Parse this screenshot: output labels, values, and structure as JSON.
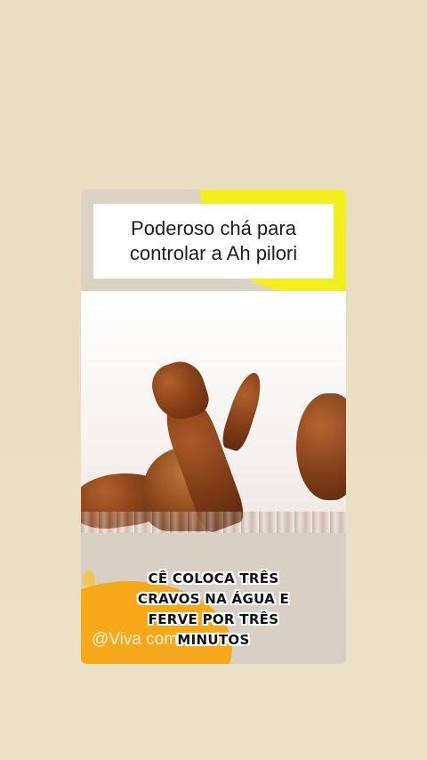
{
  "title": {
    "line1": "Poderoso chá para",
    "line2": "controlar a Ah pilori"
  },
  "watermark": "@Viva com saúde",
  "caption": {
    "line1": "CÊ COLOCA TRÊS",
    "line2": "CRAVOS NA ÁGUA E",
    "line3": "FERVE POR TRÊS",
    "line4": "MINUTOS"
  },
  "colors": {
    "background": "#e9dec2",
    "accent_yellow": "#f5ee1e",
    "accent_orange": "#f4a81a"
  }
}
